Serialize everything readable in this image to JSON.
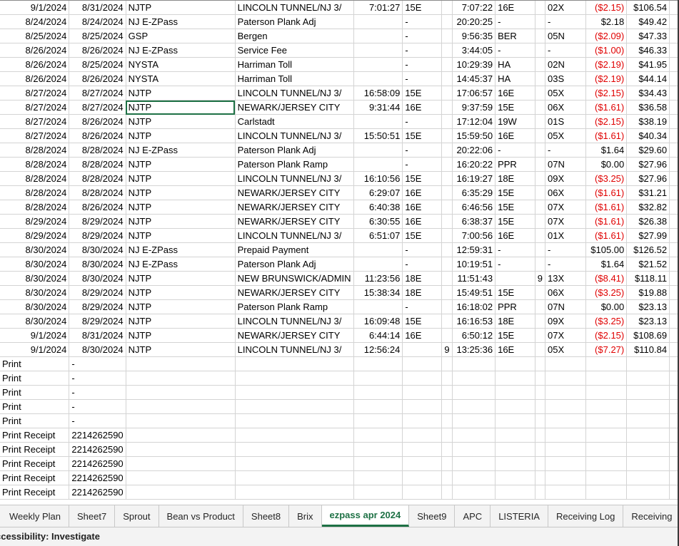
{
  "rows": [
    [
      "9/1/2024",
      "8/31/2024",
      "NJTP",
      "LINCOLN TUNNEL/NJ 3/",
      "7:01:27",
      "15E",
      "",
      "7:07:22",
      "16E",
      "",
      "02X",
      "($2.15)",
      "$106.54"
    ],
    [
      "8/24/2024",
      "8/24/2024",
      "NJ E-ZPass",
      "Paterson Plank Adj",
      "",
      "-",
      "",
      "20:20:25",
      "-",
      "",
      "-",
      "$2.18",
      "$49.42"
    ],
    [
      "8/25/2024",
      "8/25/2024",
      "GSP",
      "Bergen",
      "",
      "-",
      "",
      "9:56:35",
      "BER",
      "",
      "05N",
      "($2.09)",
      "$47.33"
    ],
    [
      "8/26/2024",
      "8/26/2024",
      "NJ E-ZPass",
      "Service Fee",
      "",
      "-",
      "",
      "3:44:05",
      "-",
      "",
      "-",
      "($1.00)",
      "$46.33"
    ],
    [
      "8/26/2024",
      "8/25/2024",
      "NYSTA",
      "Harriman Toll",
      "",
      "-",
      "",
      "10:29:39",
      "HA",
      "",
      "02N",
      "($2.19)",
      "$41.95"
    ],
    [
      "8/26/2024",
      "8/26/2024",
      "NYSTA",
      "Harriman Toll",
      "",
      "-",
      "",
      "14:45:37",
      "HA",
      "",
      "03S",
      "($2.19)",
      "$44.14"
    ],
    [
      "8/27/2024",
      "8/27/2024",
      "NJTP",
      "LINCOLN TUNNEL/NJ 3/",
      "16:58:09",
      "15E",
      "",
      "17:06:57",
      "16E",
      "",
      "05X",
      "($2.15)",
      "$34.43"
    ],
    [
      "8/27/2024",
      "8/27/2024",
      "NJTP",
      "NEWARK/JERSEY CITY",
      "9:31:44",
      "16E",
      "",
      "9:37:59",
      "15E",
      "",
      "06X",
      "($1.61)",
      "$36.58"
    ],
    [
      "8/27/2024",
      "8/26/2024",
      "NJTP",
      "Carlstadt",
      "",
      "-",
      "",
      "17:12:04",
      "19W",
      "",
      "01S",
      "($2.15)",
      "$38.19"
    ],
    [
      "8/27/2024",
      "8/26/2024",
      "NJTP",
      "LINCOLN TUNNEL/NJ 3/",
      "15:50:51",
      "15E",
      "",
      "15:59:50",
      "16E",
      "",
      "05X",
      "($1.61)",
      "$40.34"
    ],
    [
      "8/28/2024",
      "8/28/2024",
      "NJ E-ZPass",
      "Paterson Plank Adj",
      "",
      "-",
      "",
      "20:22:06",
      "-",
      "",
      "-",
      "$1.64",
      "$29.60"
    ],
    [
      "8/28/2024",
      "8/28/2024",
      "NJTP",
      "Paterson Plank Ramp",
      "",
      "-",
      "",
      "16:20:22",
      "PPR",
      "",
      "07N",
      "$0.00",
      "$27.96"
    ],
    [
      "8/28/2024",
      "8/28/2024",
      "NJTP",
      "LINCOLN TUNNEL/NJ 3/",
      "16:10:56",
      "15E",
      "",
      "16:19:27",
      "18E",
      "",
      "09X",
      "($3.25)",
      "$27.96"
    ],
    [
      "8/28/2024",
      "8/28/2024",
      "NJTP",
      "NEWARK/JERSEY CITY",
      "6:29:07",
      "16E",
      "",
      "6:35:29",
      "15E",
      "",
      "06X",
      "($1.61)",
      "$31.21"
    ],
    [
      "8/28/2024",
      "8/26/2024",
      "NJTP",
      "NEWARK/JERSEY CITY",
      "6:40:38",
      "16E",
      "",
      "6:46:56",
      "15E",
      "",
      "07X",
      "($1.61)",
      "$32.82"
    ],
    [
      "8/29/2024",
      "8/29/2024",
      "NJTP",
      "NEWARK/JERSEY CITY",
      "6:30:55",
      "16E",
      "",
      "6:38:37",
      "15E",
      "",
      "07X",
      "($1.61)",
      "$26.38"
    ],
    [
      "8/29/2024",
      "8/29/2024",
      "NJTP",
      "LINCOLN TUNNEL/NJ 3/",
      "6:51:07",
      "15E",
      "",
      "7:00:56",
      "16E",
      "",
      "01X",
      "($1.61)",
      "$27.99"
    ],
    [
      "8/30/2024",
      "8/30/2024",
      "NJ E-ZPass",
      "Prepaid Payment",
      "",
      "-",
      "",
      "12:59:31",
      "-",
      "",
      "-",
      "$105.00",
      "$126.52"
    ],
    [
      "8/30/2024",
      "8/30/2024",
      "NJ E-ZPass",
      "Paterson Plank Adj",
      "",
      "-",
      "",
      "10:19:51",
      "-",
      "",
      "-",
      "$1.64",
      "$21.52"
    ],
    [
      "8/30/2024",
      "8/30/2024",
      "NJTP",
      "NEW BRUNSWICK/ADMIN",
      "11:23:56",
      "18E",
      "",
      "11:51:43",
      "",
      "9",
      "13X",
      "($8.41)",
      "$118.11"
    ],
    [
      "8/30/2024",
      "8/29/2024",
      "NJTP",
      "NEWARK/JERSEY CITY",
      "15:38:34",
      "18E",
      "",
      "15:49:51",
      "15E",
      "",
      "06X",
      "($3.25)",
      "$19.88"
    ],
    [
      "8/30/2024",
      "8/29/2024",
      "NJTP",
      "Paterson Plank Ramp",
      "",
      "-",
      "",
      "16:18:02",
      "PPR",
      "",
      "07N",
      "$0.00",
      "$23.13"
    ],
    [
      "8/30/2024",
      "8/29/2024",
      "NJTP",
      "LINCOLN TUNNEL/NJ 3/",
      "16:09:48",
      "15E",
      "",
      "16:16:53",
      "18E",
      "",
      "09X",
      "($3.25)",
      "$23.13"
    ],
    [
      "9/1/2024",
      "8/31/2024",
      "NJTP",
      "NEWARK/JERSEY CITY",
      "6:44:14",
      "16E",
      "",
      "6:50:12",
      "15E",
      "",
      "07X",
      "($2.15)",
      "$108.69"
    ],
    [
      "9/1/2024",
      "8/30/2024",
      "NJTP",
      "LINCOLN TUNNEL/NJ 3/",
      "12:56:24",
      "",
      "9",
      "13:25:36",
      "16E",
      "",
      "05X",
      "($7.27)",
      "$110.84"
    ]
  ],
  "print_rows": [
    [
      "Print",
      "-"
    ],
    [
      "Print",
      "-"
    ],
    [
      "Print",
      "-"
    ],
    [
      "Print",
      "-"
    ],
    [
      "Print",
      "-"
    ],
    [
      "Print Receipt",
      "2214262590"
    ],
    [
      "Print Receipt",
      "2214262590"
    ],
    [
      "Print Receipt",
      "2214262590"
    ],
    [
      "Print Receipt",
      "2214262590"
    ],
    [
      "Print Receipt",
      "2214262590"
    ]
  ],
  "tabs": [
    "Weekly Plan",
    "Sheet7",
    "Sprout",
    "Bean vs Product",
    "Sheet8",
    "Brix",
    "ezpass apr 2024",
    "Sheet9",
    "APC",
    "LISTERIA",
    "Receiving Log",
    "Receiving"
  ],
  "active_tab": "ezpass apr 2024",
  "status": "ccessibility: Investigate",
  "colors": {
    "negative": "#e00000",
    "accent": "#1e7145"
  }
}
